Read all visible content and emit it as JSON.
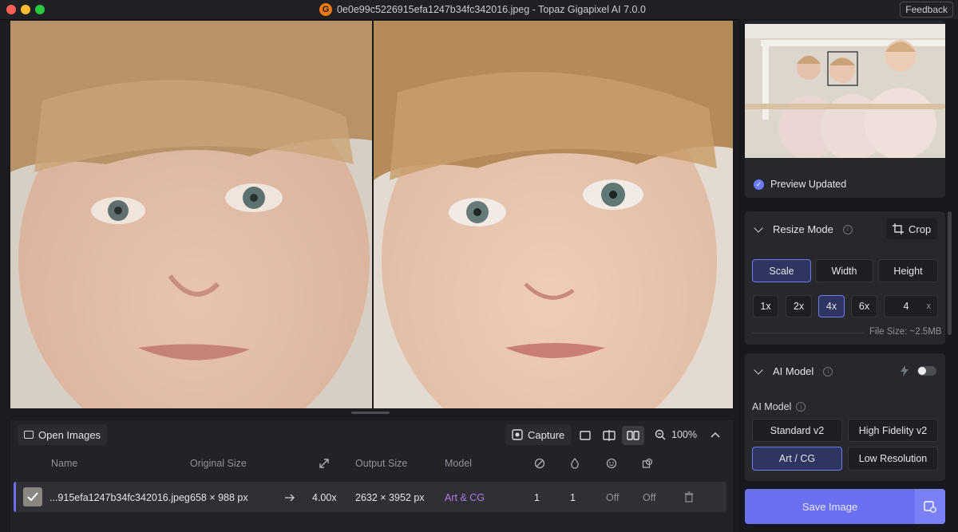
{
  "window": {
    "title": "0e0e99c5226915efa1247b34fc342016.jpeg - Topaz Gigapixel AI 7.0.0",
    "feedback_label": "Feedback"
  },
  "toolbar": {
    "open_images": "Open Images",
    "capture": "Capture",
    "zoom": "100%"
  },
  "queue": {
    "headers": {
      "name": "Name",
      "original_size": "Original Size",
      "output_size": "Output Size",
      "model": "Model"
    },
    "row": {
      "name": "...915efa1247b34fc342016.jpeg",
      "original_size": "658 × 988 px",
      "scale": "4.00x",
      "output_size": "2632 × 3952 px",
      "model": "Art & CG",
      "col1": "1",
      "col2": "1",
      "col3": "Off",
      "col4": "Off"
    }
  },
  "preview": {
    "status": "Preview Updated"
  },
  "resize": {
    "title": "Resize Mode",
    "crop": "Crop",
    "modes": [
      "Scale",
      "Width",
      "Height"
    ],
    "active_mode": "Scale",
    "scales": [
      "1x",
      "2x",
      "4x",
      "6x"
    ],
    "active_scale": "4x",
    "custom_value": "4",
    "custom_unit": "x",
    "file_size": "File Size: ~2.5MB"
  },
  "ai_model": {
    "title": "AI Model",
    "label": "AI Model",
    "options": [
      "Standard v2",
      "High Fidelity v2",
      "Art / CG",
      "Low Resolution"
    ],
    "active": "Art / CG"
  },
  "save": {
    "label": "Save Image"
  },
  "colors": {
    "accent": "#6b70f0",
    "model_text": "#b47ae6",
    "row_marker": "#6e6ff5"
  }
}
